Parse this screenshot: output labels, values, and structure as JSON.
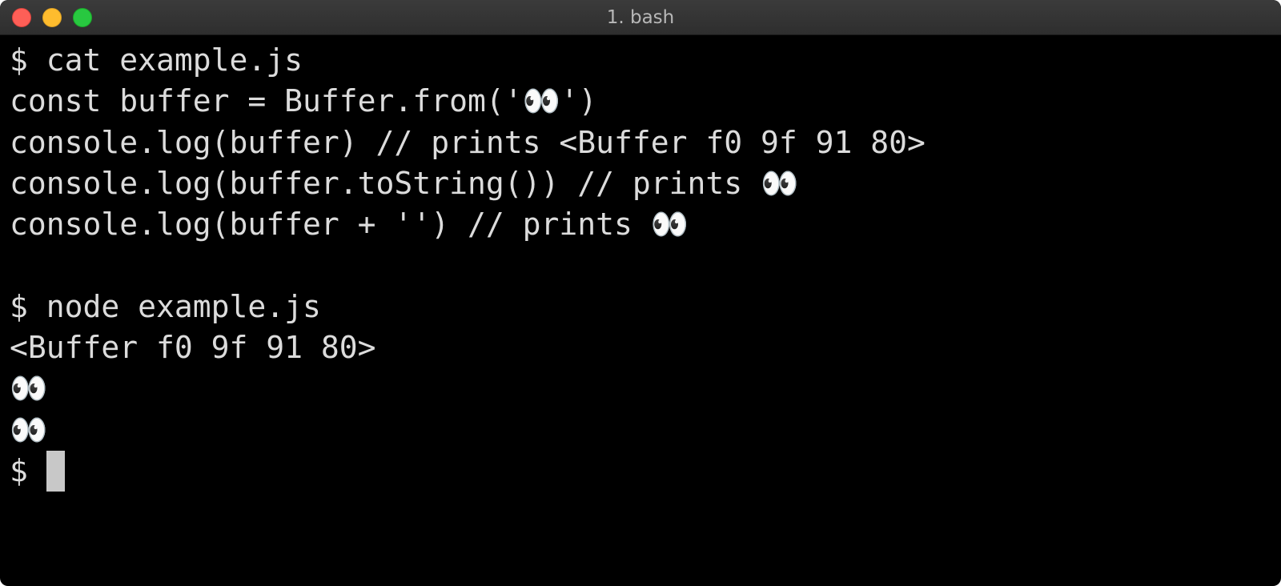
{
  "window": {
    "title": "1. bash",
    "colors": {
      "close": "#fe5f57",
      "minimize": "#febc2e",
      "zoom": "#28c840",
      "background": "#000000",
      "text": "#dcdcdc",
      "cursor": "#c8c8c8"
    }
  },
  "terminal": {
    "lines": [
      "$ cat example.js",
      "const buffer = Buffer.from('👀')",
      "console.log(buffer) // prints <Buffer f0 9f 91 80>",
      "console.log(buffer.toString()) // prints 👀",
      "console.log(buffer + '') // prints 👀",
      "",
      "$ node example.js",
      "<Buffer f0 9f 91 80>",
      "👀",
      "👀"
    ],
    "prompt": "$ "
  }
}
